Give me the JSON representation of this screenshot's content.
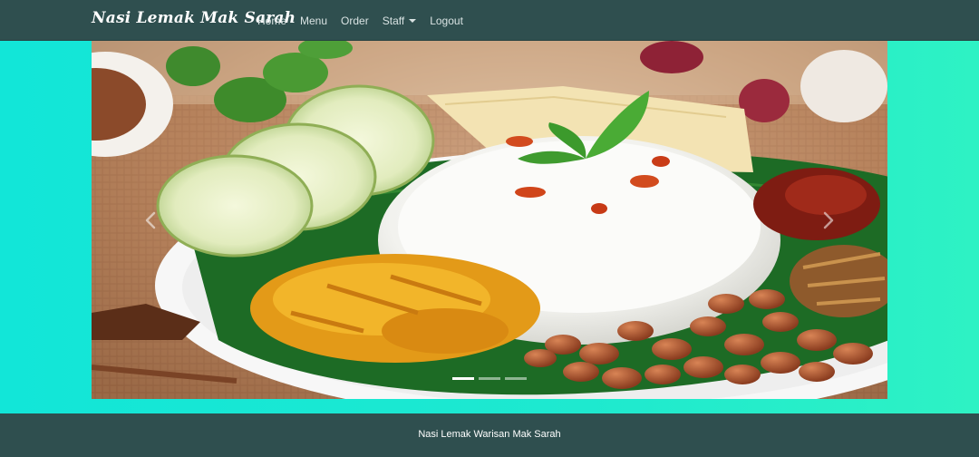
{
  "navbar": {
    "brand": "Nasi Lemak Mak Sarah",
    "links": [
      {
        "label": "Home"
      },
      {
        "label": "Menu"
      },
      {
        "label": "Order"
      },
      {
        "label": "Staff"
      },
      {
        "label": "Logout"
      }
    ]
  },
  "carousel": {
    "slide_count": 3,
    "active_index": 0,
    "image_subject": "nasi lemak plate with rice, cucumber, sambal, peanuts and achar on banana leaf",
    "prev_icon": "chevron-left-icon",
    "next_icon": "chevron-right-icon"
  },
  "footer": {
    "text": "Nasi Lemak Warisan Mak Sarah"
  },
  "colors": {
    "navbar_bg": "#2f4f4f",
    "page_bg": "#12e6d8",
    "footer_bg": "#2f4f4f"
  }
}
